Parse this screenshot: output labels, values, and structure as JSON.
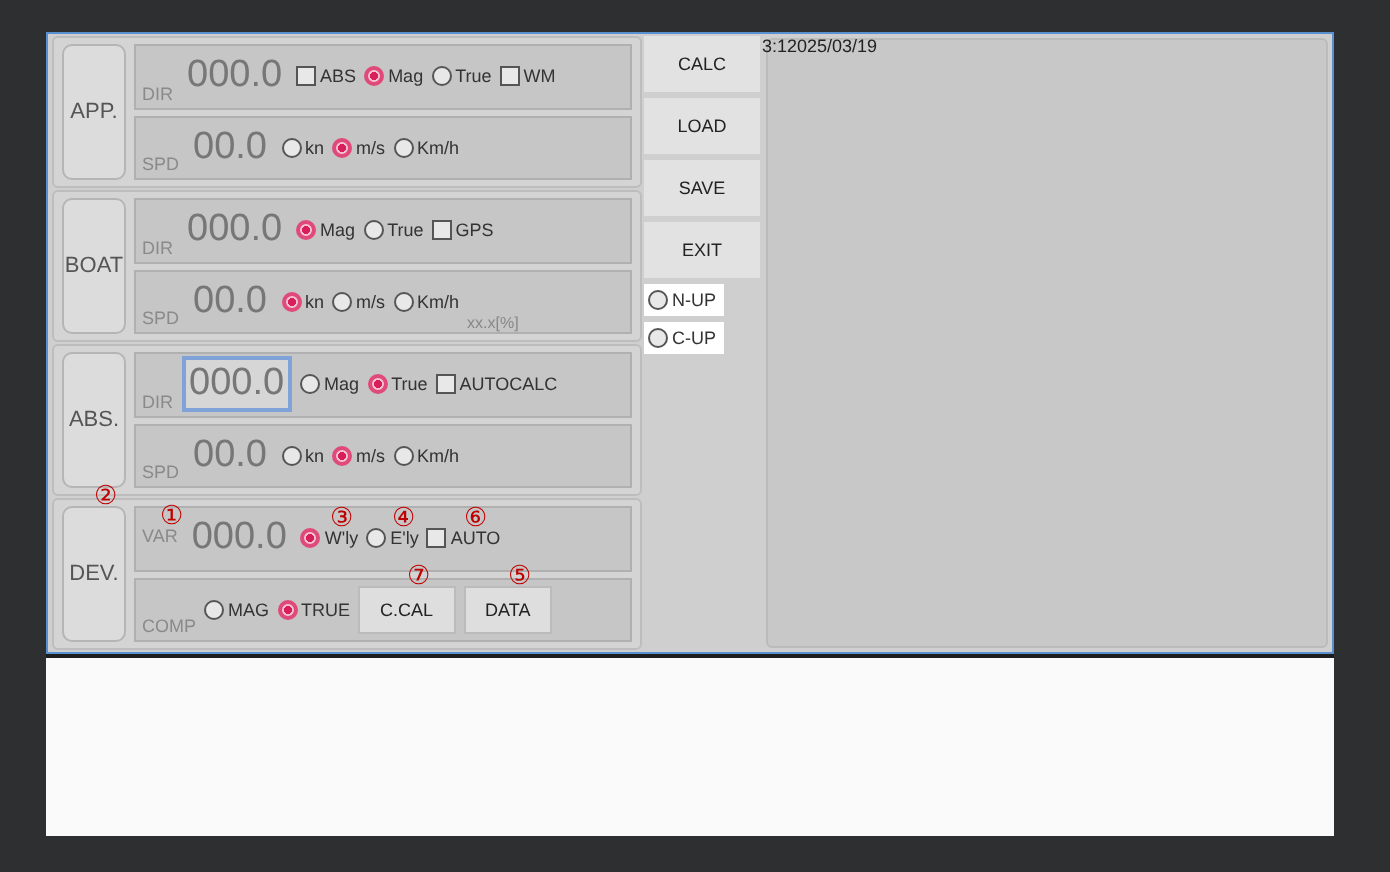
{
  "sections": [
    {
      "label": "APP.",
      "rows": [
        {
          "items": [
            {
              "kind": "label",
              "text": "DIR"
            },
            {
              "kind": "value",
              "text": "000.0",
              "focused": false
            },
            {
              "kind": "checkbox",
              "text": "ABS",
              "checked": false
            },
            {
              "kind": "radio",
              "text": "Mag",
              "selected": true
            },
            {
              "kind": "radio",
              "text": "True",
              "selected": false
            },
            {
              "kind": "checkbox",
              "text": "WM",
              "checked": false
            }
          ]
        },
        {
          "items": [
            {
              "kind": "label",
              "text": "SPD"
            },
            {
              "kind": "value",
              "text": "00.0",
              "focused": false
            },
            {
              "kind": "radio",
              "text": "kn",
              "selected": false
            },
            {
              "kind": "radio",
              "text": "m/s",
              "selected": true
            },
            {
              "kind": "radio",
              "text": "Km/h",
              "selected": false
            }
          ]
        }
      ]
    },
    {
      "label": "BOAT",
      "rows": [
        {
          "items": [
            {
              "kind": "label",
              "text": "DIR"
            },
            {
              "kind": "value",
              "text": "000.0",
              "focused": false
            },
            {
              "kind": "radio",
              "text": "Mag",
              "selected": true
            },
            {
              "kind": "radio",
              "text": "True",
              "selected": false
            },
            {
              "kind": "checkbox",
              "text": "GPS",
              "checked": false
            }
          ]
        },
        {
          "items": [
            {
              "kind": "label",
              "text": "SPD"
            },
            {
              "kind": "value",
              "text": "00.0",
              "focused": false
            },
            {
              "kind": "radio",
              "text": "kn",
              "selected": true
            },
            {
              "kind": "radio",
              "text": "m/s",
              "selected": false
            },
            {
              "kind": "radio",
              "text": "Km/h",
              "selected": false
            },
            {
              "kind": "unit",
              "text": "xx.x[%]"
            }
          ]
        }
      ]
    },
    {
      "label": "ABS.",
      "rows": [
        {
          "items": [
            {
              "kind": "label",
              "text": "DIR"
            },
            {
              "kind": "value",
              "text": "000.0",
              "focused": true
            },
            {
              "kind": "radio",
              "text": "Mag",
              "selected": false
            },
            {
              "kind": "radio",
              "text": "True",
              "selected": true
            },
            {
              "kind": "checkbox",
              "text": "AUTOCALC",
              "checked": false
            }
          ]
        },
        {
          "items": [
            {
              "kind": "label",
              "text": "SPD"
            },
            {
              "kind": "value",
              "text": "00.0",
              "focused": false
            },
            {
              "kind": "radio",
              "text": "kn",
              "selected": false
            },
            {
              "kind": "radio",
              "text": "m/s",
              "selected": true
            },
            {
              "kind": "radio",
              "text": "Km/h",
              "selected": false
            }
          ]
        }
      ]
    },
    {
      "label": "DEV.",
      "annotation": "②",
      "rows": [
        {
          "items": [
            {
              "kind": "label",
              "text": "VAR",
              "annotation": "①"
            },
            {
              "kind": "value",
              "text": "000.0",
              "focused": false
            },
            {
              "kind": "radio",
              "text": "W'ly",
              "selected": true,
              "annotation": "③"
            },
            {
              "kind": "radio",
              "text": "E'ly",
              "selected": false,
              "annotation": "④"
            },
            {
              "kind": "checkbox",
              "text": "AUTO",
              "checked": false,
              "annotation": "⑥"
            }
          ]
        },
        {
          "items": [
            {
              "kind": "label",
              "text": "COMP"
            },
            {
              "kind": "radio",
              "text": "MAG",
              "selected": false
            },
            {
              "kind": "radio",
              "text": "TRUE",
              "selected": true
            },
            {
              "kind": "button",
              "text": "C.CAL",
              "annotation": "⑦"
            },
            {
              "kind": "button",
              "text": "DATA",
              "annotation": "⑤"
            }
          ]
        }
      ]
    }
  ],
  "side_buttons": [
    "CALC",
    "LOAD",
    "SAVE",
    "EXIT"
  ],
  "orientation": [
    {
      "text": "N-UP",
      "selected": false
    },
    {
      "text": "C-UP",
      "selected": false
    }
  ],
  "datetime": "3:12025/03/19"
}
